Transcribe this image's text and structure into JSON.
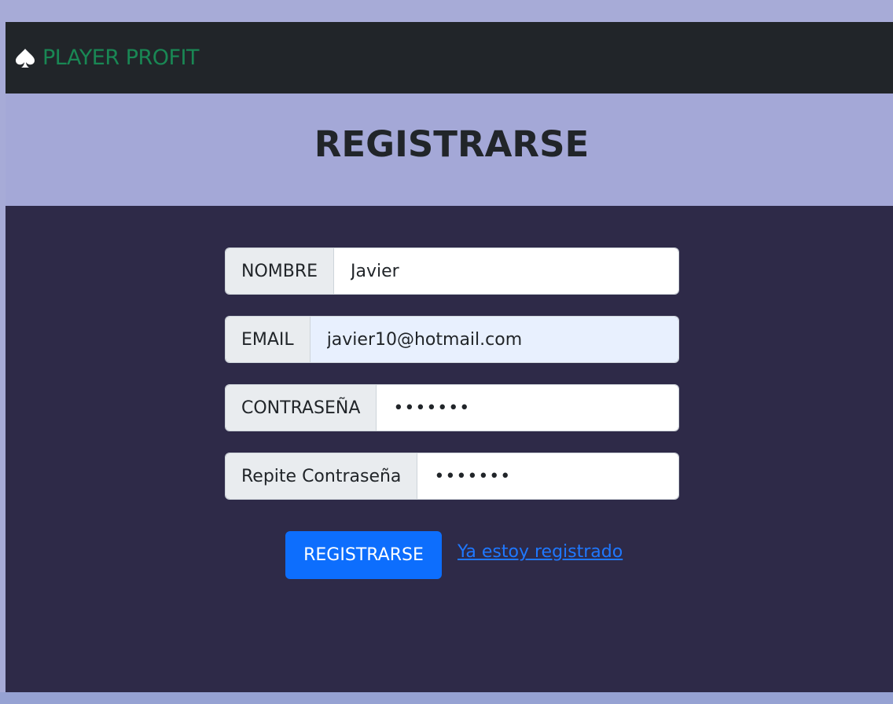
{
  "navbar": {
    "brand_icon": "spade-icon",
    "brand_text": "PLAYER PROFIT",
    "brand_color": "#198754"
  },
  "header": {
    "title": "REGISTRARSE"
  },
  "form": {
    "nombre": {
      "label": "NOMBRE",
      "value": "Javier"
    },
    "email": {
      "label": "EMAIL",
      "value": "javier10@hotmail.com"
    },
    "password": {
      "label": "CONTRASEÑA",
      "value": "•••••••"
    },
    "password_repeat": {
      "label": "Repite Contraseña",
      "value": "•••••••"
    },
    "submit_label": "REGISTRARSE",
    "login_link": "Ya estoy registrado"
  },
  "colors": {
    "page_background": "#a7abd7",
    "navbar_background": "#212529",
    "panel_background": "#2e2a48",
    "primary_button": "#0d6efd",
    "link": "#1f78ff"
  }
}
